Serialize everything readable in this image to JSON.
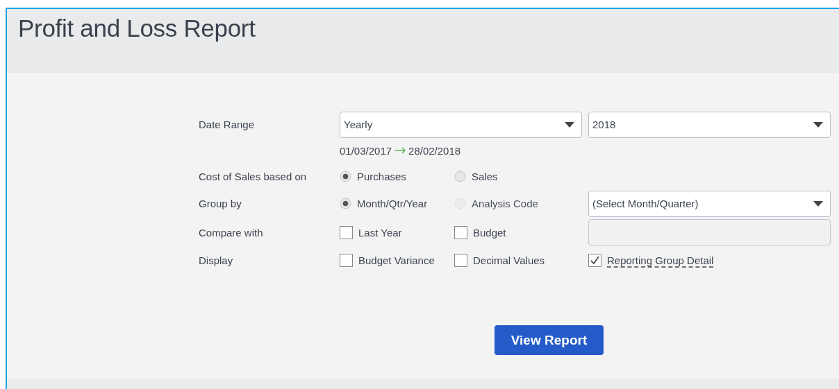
{
  "title": "Profit and Loss Report",
  "date_range": {
    "label": "Date Range",
    "period": "Yearly",
    "year": "2018",
    "from": "01/03/2017",
    "to": "28/02/2018"
  },
  "cost_of_sales": {
    "label": "Cost of Sales based on",
    "options": [
      {
        "label": "Purchases",
        "selected": true,
        "disabled": false
      },
      {
        "label": "Sales",
        "selected": false,
        "disabled": false
      }
    ]
  },
  "group_by": {
    "label": "Group by",
    "options": [
      {
        "label": "Month/Qtr/Year",
        "selected": true,
        "disabled": false
      },
      {
        "label": "Analysis Code",
        "selected": false,
        "disabled": true
      }
    ],
    "period_select": "(Select Month/Quarter)"
  },
  "compare_with": {
    "label": "Compare with",
    "options": [
      {
        "label": "Last Year",
        "checked": false
      },
      {
        "label": "Budget",
        "checked": false
      }
    ]
  },
  "display": {
    "label": "Display",
    "options": [
      {
        "label": "Budget Variance",
        "checked": false
      },
      {
        "label": "Decimal Values",
        "checked": false
      },
      {
        "label": "Reporting Group Detail",
        "checked": true
      }
    ]
  },
  "submit": "View Report"
}
